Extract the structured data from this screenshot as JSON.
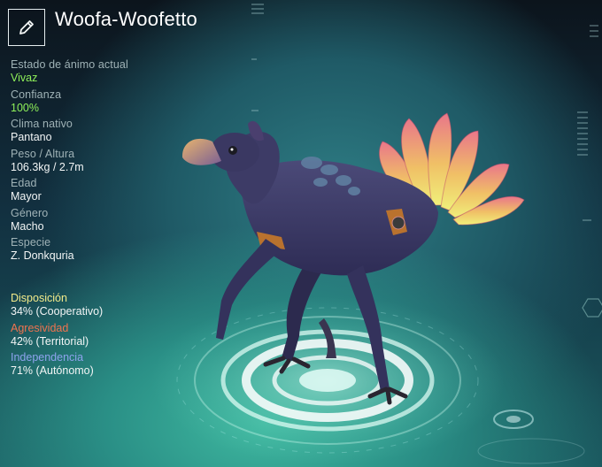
{
  "header": {
    "name": "Woofa-Woofetto",
    "edit_icon": "pencil-icon"
  },
  "stats": [
    {
      "label": "Estado de ánimo actual",
      "value": "Vivaz",
      "highlight": true
    },
    {
      "label": "Confianza",
      "value": "100%",
      "highlight": true
    },
    {
      "label": "Clima nativo",
      "value": "Pantano",
      "highlight": false
    },
    {
      "label": "Peso / Altura",
      "value": "106.3kg / 2.7m",
      "highlight": false
    },
    {
      "label": "Edad",
      "value": "Mayor",
      "highlight": false
    },
    {
      "label": "Género",
      "value": "Macho",
      "highlight": false
    },
    {
      "label": "Especie",
      "value": "Z. Donkquria",
      "highlight": false
    }
  ],
  "traits": {
    "disposition": {
      "label": "Disposición",
      "value": "34% (Cooperativo)",
      "percent": 34
    },
    "aggression": {
      "label": "Agresividad",
      "value": "42% (Territorial)",
      "percent": 42
    },
    "independence": {
      "label": "Independencia",
      "value": "71% (Autónomo)",
      "percent": 71
    }
  },
  "colors": {
    "highlight_value": "#8ff15a",
    "disposition": "#f2ea8a",
    "aggression": "#f0734f",
    "independence": "#8ea3ee"
  }
}
